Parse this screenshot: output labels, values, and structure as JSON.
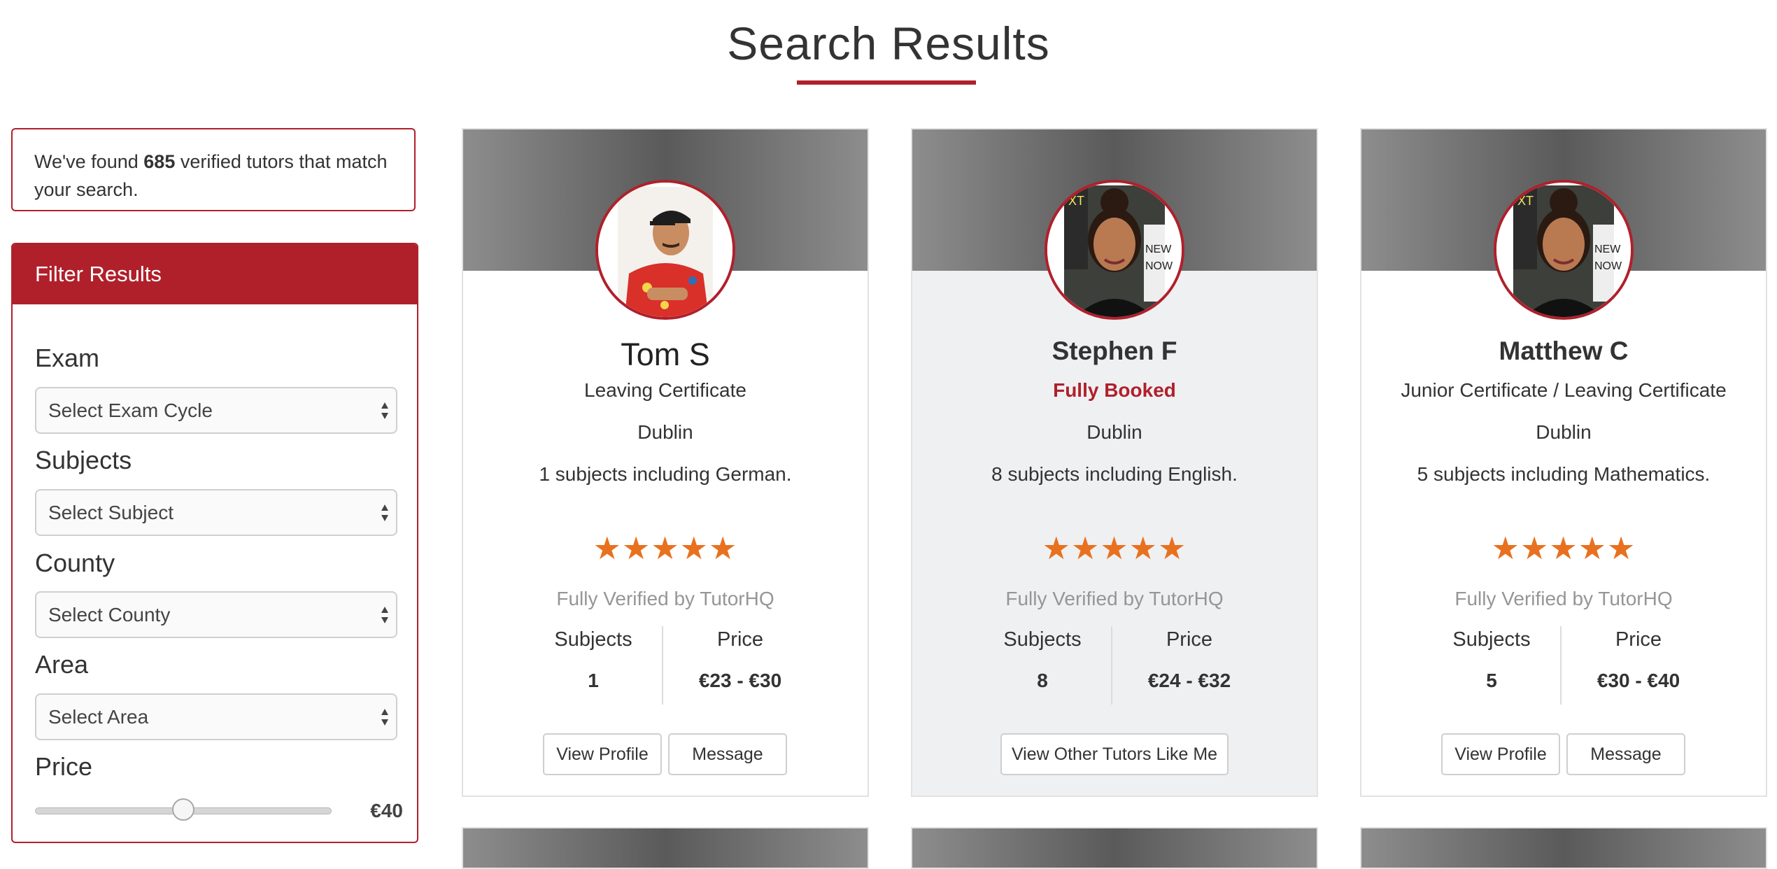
{
  "page": {
    "title": "Search Results"
  },
  "sidebar": {
    "found": {
      "prefix": "We've found",
      "count": "685",
      "suffix": "verified tutors that match your search."
    },
    "filter": {
      "heading": "Filter Results",
      "exam_label": "Exam",
      "exam_value": "Select Exam Cycle",
      "subjects_label": "Subjects",
      "subjects_value": "Select Subject",
      "county_label": "County",
      "county_value": "Select County",
      "area_label": "Area",
      "area_value": "Select Area",
      "price_label": "Price",
      "price_value": "€40",
      "price_slider_fraction": 0.5
    }
  },
  "cards": [
    {
      "name": "Tom S",
      "exam": "Leaving Certificate",
      "location": "Dublin",
      "subjects_text": "1 subjects including German.",
      "stars": "★★★★★",
      "rating": 5,
      "verified": "Fully Verified by TutorHQ",
      "subjects_label": "Subjects",
      "subjects_count": "1",
      "price_label": "Price",
      "price": "€23 - €30",
      "button_1": "View Profile",
      "button_2": "Message"
    },
    {
      "name": "Stephen F",
      "status": "Fully Booked",
      "location": "Dublin",
      "subjects_text": "8 subjects including English.",
      "stars": "★★★★★",
      "rating": 5,
      "verified": "Fully Verified by TutorHQ",
      "subjects_label": "Subjects",
      "subjects_count": "8",
      "price_label": "Price",
      "price": "€24 - €32",
      "button_1": "View Other Tutors Like Me"
    },
    {
      "name": "Matthew C",
      "exam": "Junior Certificate / Leaving Certificate",
      "location": "Dublin",
      "subjects_text": "5 subjects including Mathematics.",
      "stars": "★★★★★",
      "rating": 5,
      "verified": "Fully Verified by TutorHQ",
      "subjects_label": "Subjects",
      "subjects_count": "5",
      "price_label": "Price",
      "price": "€30 - €40",
      "button_1": "View Profile",
      "button_2": "Message"
    }
  ],
  "colors": {
    "accent": "#b0202b",
    "star": "#e8711f",
    "muted": "#969696"
  }
}
